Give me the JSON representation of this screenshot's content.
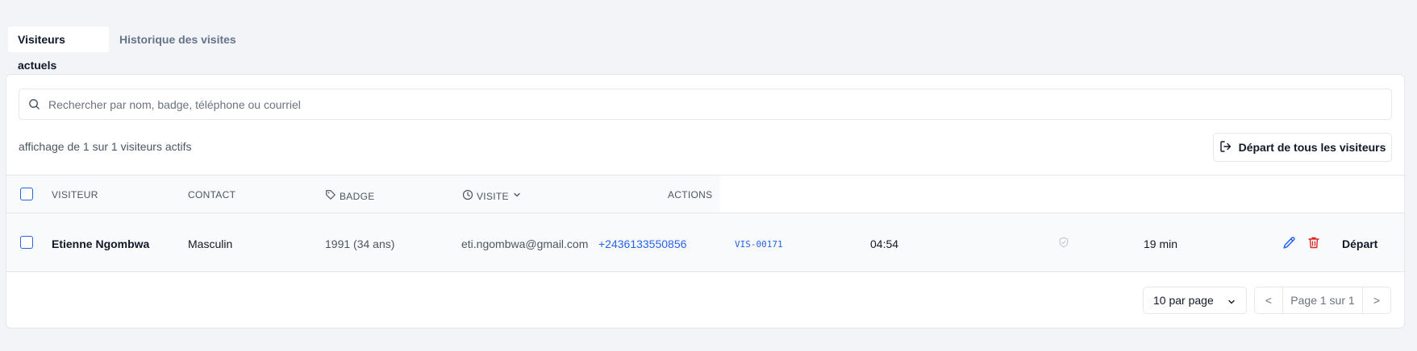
{
  "tabs": [
    {
      "label": "Visiteurs actuels",
      "active": true
    },
    {
      "label": "Historique des visites",
      "active": false
    }
  ],
  "search": {
    "placeholder": "Rechercher par nom, badge, téléphone ou courriel",
    "value": ""
  },
  "summary": "affichage de 1 sur 1 visiteurs actifs",
  "depart_all_label": "Départ de tous les visiteurs",
  "table": {
    "headers": {
      "visitor": "VISITEUR",
      "contact": "CONTACT",
      "badge": "BADGE",
      "visit": "VISITE",
      "actions": "ACTIONS"
    },
    "rows": [
      {
        "name": "Etienne Ngombwa",
        "gender": "Masculin",
        "birth": "1991 (34 ans)",
        "email": "eti.ngombwa@gmail.com",
        "phone": "+2436133550856",
        "badge": "VIS-00171",
        "time": "04:54",
        "duration": "19 min",
        "depart_label": "Départ"
      }
    ]
  },
  "pagination": {
    "per_page": "10 par page",
    "prev": "<",
    "page_label": "Page 1 sur 1",
    "next": ">"
  },
  "colors": {
    "accent": "#2563eb",
    "danger": "#dc2626",
    "background": "#f2f4f7"
  }
}
